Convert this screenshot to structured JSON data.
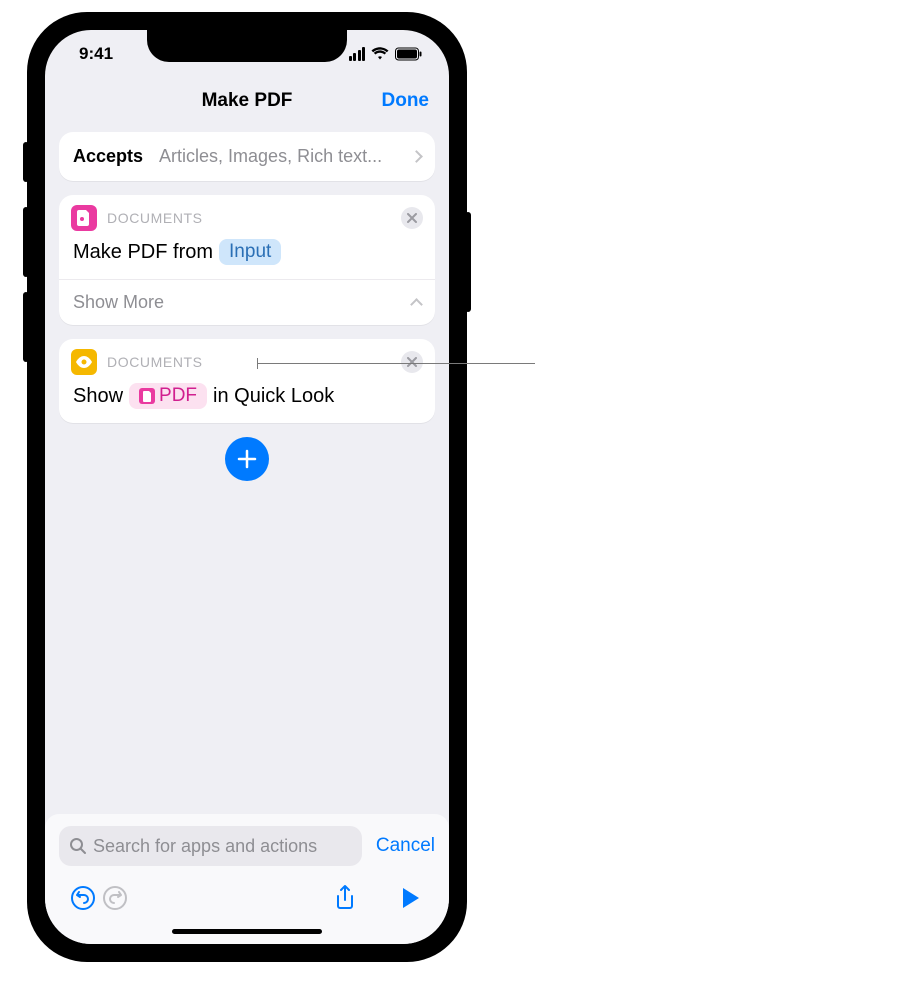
{
  "status": {
    "time": "9:41"
  },
  "nav": {
    "title": "Make PDF",
    "done": "Done"
  },
  "accepts": {
    "label": "Accepts",
    "value": "Articles, Images, Rich text..."
  },
  "action1": {
    "category": "DOCUMENTS",
    "line_prefix": "Make PDF from",
    "token": "Input",
    "show_more": "Show More"
  },
  "action2": {
    "category": "DOCUMENTS",
    "line_prefix": "Show",
    "token": "PDF",
    "line_suffix": "in Quick Look"
  },
  "search": {
    "placeholder": "Search for apps and actions",
    "cancel": "Cancel"
  },
  "icons": {
    "document": "document-icon",
    "eye": "eye-icon",
    "close": "close-icon",
    "plus": "plus-icon",
    "chevron_right": "chevron-right-icon",
    "chevron_up": "chevron-up-icon",
    "search": "search-icon",
    "undo": "undo-icon",
    "redo": "redo-icon",
    "share": "share-icon",
    "play": "play-icon",
    "signal": "cellular-signal-icon",
    "wifi": "wifi-icon",
    "battery": "battery-icon"
  }
}
